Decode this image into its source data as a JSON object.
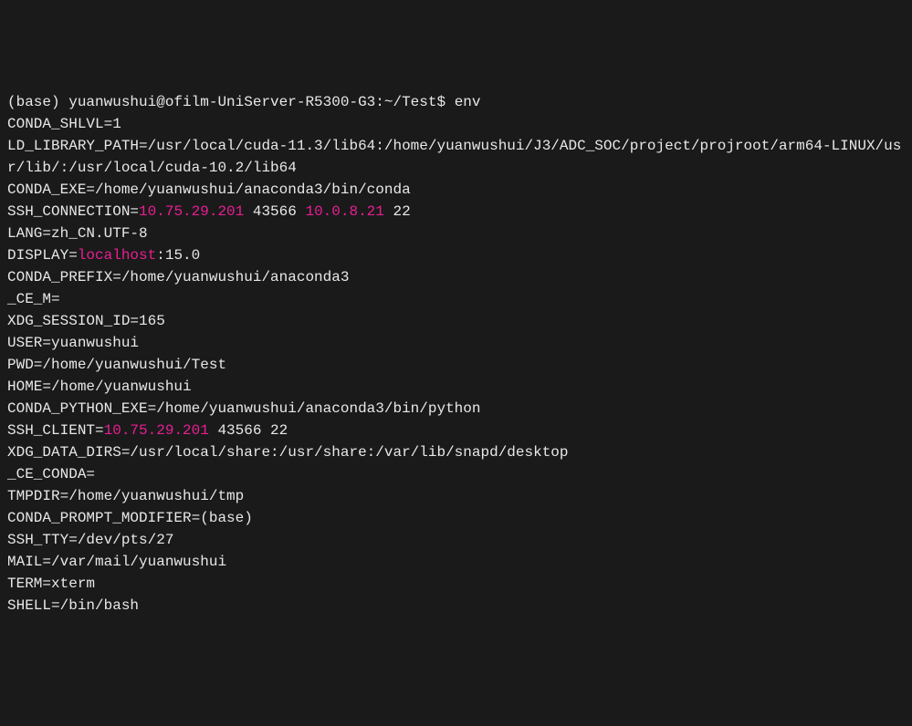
{
  "prompt": {
    "prefix": "(base) yuanwushui@ofilm-UniServer-R5300-G3:~/Test$ ",
    "command": "env"
  },
  "env": {
    "CONDA_SHLVL": "CONDA_SHLVL=1",
    "LD_LIBRARY_PATH": "LD_LIBRARY_PATH=/usr/local/cuda-11.3/lib64:/home/yuanwushui/J3/ADC_SOC/project/projroot/arm64-LINUX/usr/lib/:/usr/local/cuda-10.2/lib64",
    "CONDA_EXE": "CONDA_EXE=/home/yuanwushui/anaconda3/bin/conda",
    "SSH_CONNECTION_key": "SSH_CONNECTION=",
    "SSH_CONNECTION_ip1": "10.75.29.201",
    "SSH_CONNECTION_port1": " 43566 ",
    "SSH_CONNECTION_ip2": "10.0.8.21",
    "SSH_CONNECTION_port2": " 22",
    "LANG": "LANG=zh_CN.UTF-8",
    "DISPLAY_key": "DISPLAY=",
    "DISPLAY_host": "localhost",
    "DISPLAY_rest": ":15.0",
    "CONDA_PREFIX": "CONDA_PREFIX=/home/yuanwushui/anaconda3",
    "CE_M": "_CE_M=",
    "XDG_SESSION_ID": "XDG_SESSION_ID=165",
    "USER": "USER=yuanwushui",
    "PWD": "PWD=/home/yuanwushui/Test",
    "HOME": "HOME=/home/yuanwushui",
    "CONDA_PYTHON_EXE": "CONDA_PYTHON_EXE=/home/yuanwushui/anaconda3/bin/python",
    "SSH_CLIENT_key": "SSH_CLIENT=",
    "SSH_CLIENT_ip": "10.75.29.201",
    "SSH_CLIENT_rest": " 43566 22",
    "XDG_DATA_DIRS": "XDG_DATA_DIRS=/usr/local/share:/usr/share:/var/lib/snapd/desktop",
    "CE_CONDA": "_CE_CONDA=",
    "TMPDIR": "TMPDIR=/home/yuanwushui/tmp",
    "CONDA_PROMPT_MODIFIER": "CONDA_PROMPT_MODIFIER=(base) ",
    "SSH_TTY": "SSH_TTY=/dev/pts/27",
    "MAIL": "MAIL=/var/mail/yuanwushui",
    "TERM": "TERM=xterm",
    "SHELL": "SHELL=/bin/bash"
  }
}
